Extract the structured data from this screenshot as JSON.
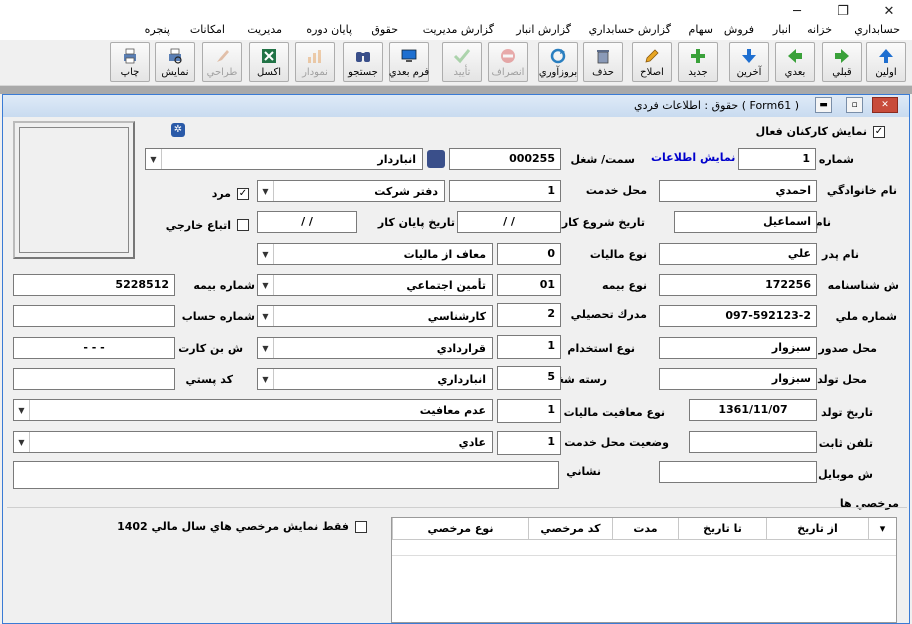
{
  "window": {
    "minimize": "─",
    "restore": "❐",
    "close": "✕"
  },
  "menu": [
    "حسابداري",
    "خزانه",
    "انبار",
    "فروش",
    "سهام",
    "گزارش حسابداري",
    "گزارش انبار",
    "گزارش مديريت",
    "حقوق",
    "پايان دوره",
    "مديريت",
    "امكانات",
    "پنجره"
  ],
  "toolbar": {
    "first": "اولين",
    "prev_page": "قبلي",
    "next": "بعدي",
    "last": "آخرين",
    "new": "جديد",
    "edit": "اصلاح",
    "delete": "حذف",
    "refresh": "بروزآوري",
    "cancel": "انصراف",
    "confirm": "تأييد",
    "next_form": "فرم بعدي",
    "search": "جستجو",
    "chart": "نمودار",
    "excel": "اكسل",
    "design": "طراحي",
    "preview": "نمايش",
    "print": "چاپ"
  },
  "form": {
    "title": "حقوق : اطلاعات فردي ( Form61 )",
    "show_active_label": "نمايش كاركنان فعال",
    "show_active_checked": true,
    "number_label": "شماره",
    "number_value": "1",
    "show_info_link": "نمايش اطلاعات",
    "position_label": "سمت/ شغل",
    "position_code": "000255",
    "position_name": "انباردار",
    "family_label": "نام خانوادگي",
    "family_value": "احمدي",
    "workplace_label": "محل خدمت",
    "workplace_code": "1",
    "workplace_name": "دفتر شركت",
    "male_label": "مرد",
    "male_checked": true,
    "name_label": "نام",
    "name_value": "اسماعيل",
    "start_date_label": "تاريخ شروع كار",
    "start_date_value": "/ /",
    "end_date_label": "تاريخ پايان كار",
    "end_date_value": "/ /",
    "foreign_label": "اتباع خارجي",
    "foreign_checked": false,
    "father_label": "نام پدر",
    "father_value": "علي",
    "tax_type_label": "نوع ماليات",
    "tax_type_code": "0",
    "tax_type_name": "معاف از ماليات",
    "id_number_label": "ش شناسنامه",
    "id_number_value": "172256",
    "insurance_type_label": "نوع بيمه",
    "insurance_type_code": "01",
    "insurance_type_name": "تأمين اجتماعي",
    "insurance_no_label": "شماره بيمه",
    "insurance_no_value": "5228512",
    "national_id_label": "شماره ملي",
    "national_id_value": "097-592123-2",
    "degree_label": "مدرك تحصيلي",
    "degree_code": "2",
    "degree_name": "كارشناسي",
    "account_label": "شماره حساب",
    "account_value": "",
    "issue_place_label": "محل صدور",
    "issue_place_value": "سبزوار",
    "employment_label": "نوع استخدام",
    "employment_code": "1",
    "employment_name": "قراردادي",
    "voucher_label": "ش بن كارت",
    "voucher_value": "- - -",
    "birth_place_label": "محل تولد",
    "birth_place_value": "سبزوار",
    "job_cat_label": "رسته شغلي",
    "job_cat_code": "5",
    "job_cat_name": "انبارداري",
    "postal_label": "كد پستي",
    "postal_value": "",
    "birth_date_label": "تاريخ تولد",
    "birth_date_value": "1361/11/07",
    "tax_exempt_label": "نوع معافيت ماليات",
    "tax_exempt_code": "1",
    "tax_exempt_name": "عدم معافيت",
    "phone_label": "تلفن ثابت",
    "phone_value": "",
    "work_status_label": "وضعيت محل خدمت",
    "work_status_code": "1",
    "work_status_name": "عادي",
    "mobile_label": "ش موبايل",
    "mobile_value": "",
    "address_label": "نشاني",
    "address_value": "",
    "leaves_title": "مرخصي ها",
    "leaves_filter_label": "فقط نمايش مرخصي هاي سال مالي 1402",
    "leaves_columns": [
      "از تاريخ",
      "تا تاريخ",
      "مدت",
      "كد مرخصي",
      "نوع مرخصي"
    ]
  },
  "colors": {
    "link": "#0000cc",
    "title_bg": "#c9dbf0",
    "close_red": "#c84b3b"
  }
}
